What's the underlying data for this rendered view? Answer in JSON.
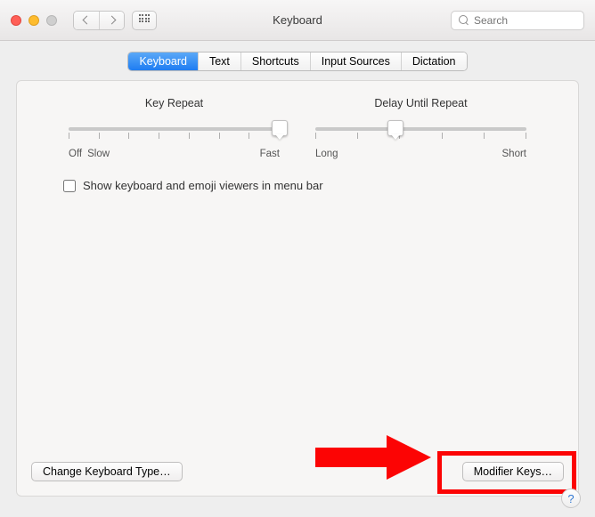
{
  "title": "Keyboard",
  "search_placeholder": "Search",
  "tabs": {
    "keyboard": "Keyboard",
    "text": "Text",
    "shortcuts": "Shortcuts",
    "input_sources": "Input Sources",
    "dictation": "Dictation"
  },
  "key_repeat": {
    "title": "Key Repeat",
    "left": "Off",
    "mid_left": "Slow",
    "right": "Fast",
    "ticks": 8,
    "position_pct": 100
  },
  "delay_repeat": {
    "title": "Delay Until Repeat",
    "left": "Long",
    "right": "Short",
    "ticks": 6,
    "position_pct": 38
  },
  "checkbox": {
    "menu_bar_viewers": "Show keyboard and emoji viewers in menu bar",
    "checked": false
  },
  "buttons": {
    "change_keyboard_type": "Change Keyboard Type…",
    "modifier_keys": "Modifier Keys…"
  },
  "help_label": "?"
}
